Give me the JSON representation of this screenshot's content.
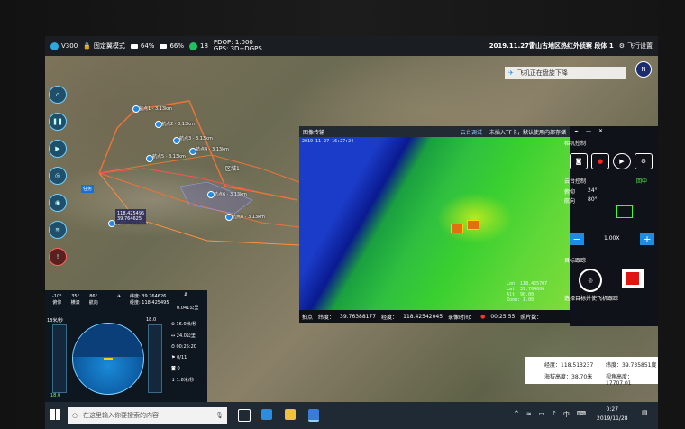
{
  "top_bar": {
    "drone_model": "V300",
    "mode": "固定翼模式",
    "battery1": "64%",
    "battery2": "66%",
    "satellites": "18",
    "pdop": "PDOP: 1.000",
    "gps": "GPS:  3D+DGPS",
    "mission": "2019.11.27雷山古地区热红外侦察 段体 1",
    "log_label": "飞行设置"
  },
  "toast": "飞机正在盘旋下降",
  "map": {
    "home_label": "任务",
    "popup_lat": "118.425495",
    "popup_lon": "39.764625",
    "area_label": "区域1",
    "waypoints": [
      "航点1 · 3.13km",
      "航点2 · 3.13km",
      "航点3 · 3.13km",
      "航点4 · 3.13km",
      "航点5 · 3.13km",
      "航点6 · 3.13km",
      "航点7 · 3.13km",
      "航点8 · 3.13km"
    ]
  },
  "video": {
    "title": "图像传输",
    "gimbal_label": "云台调试",
    "notice": "未插入TF卡，默认使用内部存储",
    "overlay_time": "2019-11-27 16:27:24",
    "overlay_stats": [
      "Lon: 118.425707",
      "Lat:  39.764606",
      "Alt:  90.00",
      "Zoom: 1.00"
    ],
    "foot_label": "拍点",
    "foot_lat_label": "纬度：",
    "foot_lat": "39.76388177",
    "foot_lon_label": "经度：",
    "foot_lon": "118.42542045",
    "rec_label": "录像时间：",
    "rec_time": "00:25:55",
    "photos_label": "照片数："
  },
  "right_panel": {
    "camera_title": "相机控制",
    "gimbal_title": "云台控制",
    "reset_label": "回中",
    "pitch_label": "俯仰",
    "pitch": "24°",
    "yaw_label": "航向",
    "yaw": "80°",
    "zoom_value": "1.00X",
    "target_title": "目标跟踪",
    "target_hint": "选择目标并使飞机跟踪"
  },
  "flight_panel": {
    "angles": [
      "-10°",
      "35°",
      "86°"
    ],
    "angle_labels": [
      "俯仰",
      "横滚",
      "航向"
    ],
    "lat_label": "纬度",
    "lat": "39.764626",
    "lon_label": "经度",
    "lon": "118.425495",
    "distance": "0.041公里",
    "speed_label": "18米/秒",
    "stats": [
      "16.0米/秒",
      "24.0公里",
      "00:25:20",
      "0/11",
      "0",
      "1.8米/秒"
    ],
    "alt_top": "18.0",
    "alt_bottom": "18.0"
  },
  "bottom_info": {
    "lon_label": "经度：",
    "lon": "118.513237",
    "lat_label": "纬度：",
    "lat": "39.735851度",
    "alt_label": "海拔高度：",
    "alt": "38.70米",
    "view_alt_label": "视角高度：",
    "view_alt": "17707.01"
  },
  "taskbar": {
    "search_placeholder": "在这里输入你要搜索的内容",
    "ime": "中",
    "time": "0:27",
    "date": "2019/11/28"
  }
}
